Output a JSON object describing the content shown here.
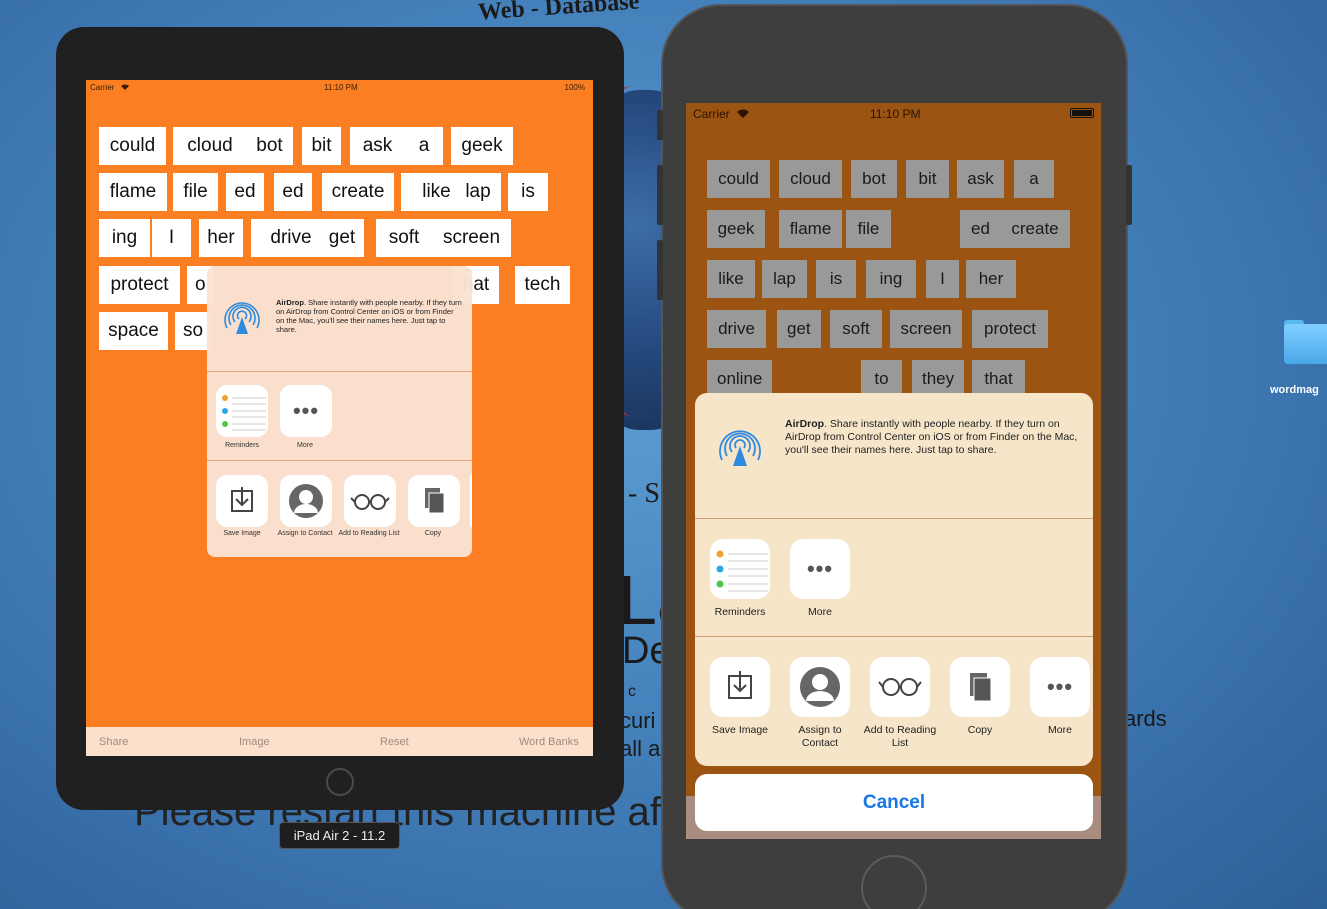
{
  "backdrop": {
    "arc_text": "Web - Database",
    "la_text": "La",
    "de_text": "De",
    "c_text": "c",
    "s_text": "- S",
    "curi_text": "curi",
    "alla_text": "all a",
    "ards_text": "ards",
    "restart_text": "Please restart this machine after",
    "folder_label": "wordmag",
    "device_badge": "iPad Air 2 - 11.2"
  },
  "ipad": {
    "status": {
      "carrier": "Carrier",
      "time": "11:10 PM",
      "battery": "100%"
    },
    "words": [
      "could",
      "cloud",
      "bot",
      "bit",
      "ask",
      "a",
      "geek",
      "flame",
      "file",
      "ed",
      "ed",
      "create",
      "like",
      "lap",
      "is",
      "ing",
      "I",
      "her",
      "drive",
      "get",
      "soft",
      "screen",
      "protect",
      "o",
      "hat",
      "tech",
      "space",
      "so"
    ],
    "toolbar": {
      "share": "Share",
      "image": "Image",
      "reset": "Reset",
      "word_banks": "Word Banks"
    },
    "share_sheet": {
      "airdrop_title": "AirDrop",
      "airdrop_text": ". Share instantly with people nearby. If they turn on AirDrop from Control Center on iOS or from Finder on the Mac, you'll see their names here. Just tap to share.",
      "row1": [
        "Reminders",
        "More"
      ],
      "row2": [
        "Save Image",
        "Assign to Contact",
        "Add to Reading List",
        "Copy"
      ]
    }
  },
  "iphone": {
    "status": {
      "carrier": "Carrier",
      "time": "11:10 PM"
    },
    "words": [
      "could",
      "cloud",
      "bot",
      "bit",
      "ask",
      "a",
      "geek",
      "flame",
      "file",
      "ed",
      "create",
      "like",
      "lap",
      "is",
      "ing",
      "I",
      "her",
      "drive",
      "get",
      "soft",
      "screen",
      "protect",
      "online",
      "to",
      "they",
      "that"
    ],
    "share_sheet": {
      "airdrop_title": "AirDrop",
      "airdrop_text": ". Share instantly with people nearby. If they turn on AirDrop from Control Center on iOS or from Finder on the Mac, you'll see their names here. Just tap to share.",
      "row1": [
        "Reminders",
        "More"
      ],
      "row2": [
        "Save Image",
        "Assign to Contact",
        "Add to Reading List",
        "Copy",
        "More"
      ]
    },
    "cancel_label": "Cancel"
  },
  "colors": {
    "ipad_bg": "#fb7f22",
    "iphone_bg": "#9c5413",
    "tile_ipad": "#ffffff",
    "tile_iphone": "#999999",
    "cancel": "#1877e8"
  },
  "icons": {
    "airdrop": "airdrop-icon",
    "reminders": "reminders-icon",
    "more": "more-icon",
    "save_image": "save-image-icon",
    "assign_contact": "contact-icon",
    "reading_list": "glasses-icon",
    "copy": "copy-icon",
    "wifi": "wifi-icon"
  }
}
